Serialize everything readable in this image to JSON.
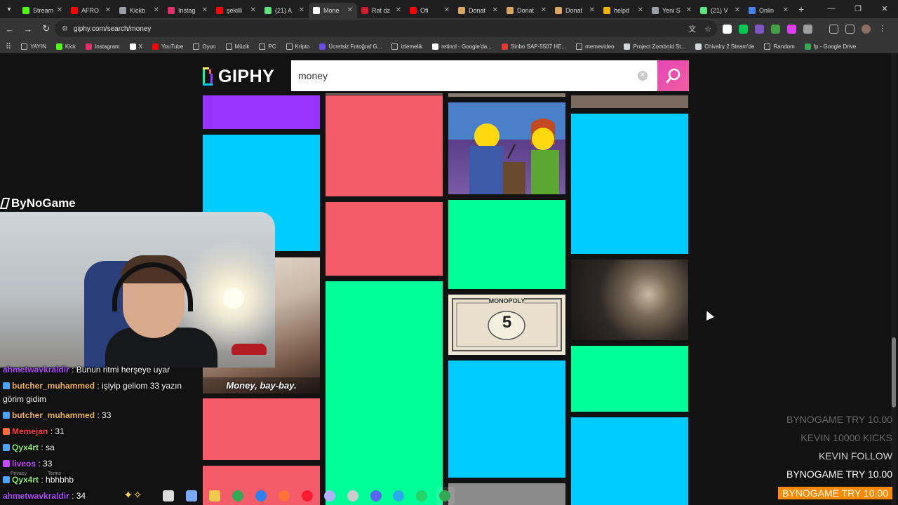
{
  "browser": {
    "tabs": [
      {
        "label": "Stream",
        "color": "#53fc18"
      },
      {
        "label": "AFRO",
        "color": "#ff0000"
      },
      {
        "label": "Kickb",
        "color": "#9aa0a6"
      },
      {
        "label": "Instag",
        "color": "#e1306c"
      },
      {
        "label": "şekilli",
        "color": "#ff0000"
      },
      {
        "label": "(21) A",
        "color": "#5ee37f"
      },
      {
        "label": "Mone",
        "color": "#ffffff",
        "active": true
      },
      {
        "label": "Rat dz",
        "color": "#d11a2a"
      },
      {
        "label": "Ofi",
        "color": "#ff0000"
      },
      {
        "label": "Donat",
        "color": "#d9a760"
      },
      {
        "label": "Donat",
        "color": "#d9a760"
      },
      {
        "label": "Donat",
        "color": "#d9a760"
      },
      {
        "label": "helpd",
        "color": "#f4b400"
      },
      {
        "label": "Yeni S",
        "color": "#9aa0a6"
      },
      {
        "label": "(21) V",
        "color": "#5ee37f"
      },
      {
        "label": "Onlin",
        "color": "#4285f4"
      }
    ],
    "url": "giphy.com/search/money",
    "bookmarks": [
      {
        "label": "YAYIN",
        "color": "folder"
      },
      {
        "label": "Kick",
        "color": "#53fc18"
      },
      {
        "label": "Instagram",
        "color": "#e1306c"
      },
      {
        "label": "X",
        "color": "#ffffff"
      },
      {
        "label": "YouTube",
        "color": "#ff0000"
      },
      {
        "label": "Oyun",
        "color": "folder"
      },
      {
        "label": "Müzik",
        "color": "folder"
      },
      {
        "label": "PC",
        "color": "folder"
      },
      {
        "label": "Kripto",
        "color": "folder"
      },
      {
        "label": "Ücretsiz Fotoğraf G...",
        "color": "#6b4ce6"
      },
      {
        "label": "izlemelik",
        "color": "folder"
      },
      {
        "label": "retinol - Google'da...",
        "color": "#ffffff"
      },
      {
        "label": "Sinbo SAP-5507 HE...",
        "color": "#e53935"
      },
      {
        "label": "memevideo",
        "color": "folder"
      },
      {
        "label": "Project Zomboid St...",
        "color": "#cfd8dc"
      },
      {
        "label": "Chivalry 2 Steam'de",
        "color": "#cfd8dc"
      },
      {
        "label": "Random",
        "color": "folder"
      },
      {
        "label": "fp - Google Drive",
        "color": "#34a853"
      }
    ]
  },
  "giphy": {
    "logo": "GIPHY",
    "search_value": "money",
    "gifs": [
      {
        "name": "gif-purple",
        "kind": "purple"
      },
      {
        "name": "gif-cyan-1",
        "kind": "cyan"
      },
      {
        "name": "gif-money-baybay",
        "kind": "photo",
        "caption": "Money, bay-bay."
      },
      {
        "name": "gif-red-1",
        "kind": "red"
      },
      {
        "name": "gif-red-2",
        "kind": "red"
      },
      {
        "name": "gif-red-3",
        "kind": "red"
      },
      {
        "name": "gif-red-4",
        "kind": "red"
      },
      {
        "name": "gif-green-1",
        "kind": "green"
      },
      {
        "name": "gif-simpsons",
        "kind": "simpsons"
      },
      {
        "name": "gif-green-2",
        "kind": "green"
      },
      {
        "name": "gif-monopoly",
        "kind": "monopoly",
        "caption": "MONOPOLY",
        "number": "5"
      },
      {
        "name": "gif-cyan-2",
        "kind": "cyan"
      },
      {
        "name": "gif-cyan-3",
        "kind": "cyan"
      },
      {
        "name": "gif-money-sniff",
        "kind": "photo"
      },
      {
        "name": "gif-green-3",
        "kind": "green"
      },
      {
        "name": "gif-cyan-4",
        "kind": "cyan"
      },
      {
        "name": "gif-strip-top-2",
        "kind": "photo"
      },
      {
        "name": "gif-strip-top-3",
        "kind": "photo"
      },
      {
        "name": "gif-strip-top-4",
        "kind": "photo"
      },
      {
        "name": "gif-strip-bottom",
        "kind": "photo"
      }
    ]
  },
  "overlay": {
    "brand": "ByNoGame",
    "chat": [
      {
        "user": "ahmetwavkraldir",
        "text": ": Bunun ritmi herşeye uyar",
        "user_color": "#b04bff",
        "badge": ""
      },
      {
        "user": "butcher_muhammed",
        "text": ": işiyip geliom 33 yazın",
        "user_color": "#f2b84b",
        "badge": "#4aa3ff"
      },
      {
        "user": "",
        "text": "görim gidim",
        "user_color": "#ffffff",
        "badge": ""
      },
      {
        "user": "butcher_muhammed",
        "text": ": 33",
        "user_color": "#f2b84b",
        "badge": "#4aa3ff"
      },
      {
        "user": "Memejan",
        "text": ": 31",
        "user_color": "#ff3b3b",
        "badge": "#ff6a3d"
      },
      {
        "user": "Qyx4rt",
        "text": ": sa",
        "user_color": "#8af26b",
        "badge": "#4aa3ff"
      },
      {
        "user": "liveos",
        "text": ": 33",
        "user_color": "#c24bff",
        "badge": "#c24bff"
      },
      {
        "user": "Qyx4rt",
        "text": ": hbhbhb",
        "user_color": "#8af26b",
        "badge": "#4aa3ff"
      },
      {
        "user": "ahmetwavkraldir",
        "text": ": 34",
        "user_color": "#b04bff",
        "badge": ""
      }
    ],
    "footer_privacy": "Privacy",
    "footer_terms": "Terms",
    "alerts": [
      {
        "text": "BYNOGAME  TRY 10.00",
        "style": "faded"
      },
      {
        "text": "KEVIN  10000 KICKS",
        "style": "faded"
      },
      {
        "text": "KEVIN  FOLLOW",
        "style": "normal"
      },
      {
        "text": "BYNOGAME  TRY 10.00",
        "style": "bright"
      },
      {
        "text": "BYNOGAME  TRY 10.00",
        "style": "active"
      }
    ]
  },
  "taskbar": {
    "icons": [
      "task-view-icon",
      "copilot-icon",
      "file-explorer-icon",
      "chrome-icon",
      "outlook-icon",
      "firefox-icon",
      "opera-icon",
      "app-icon",
      "obs-icon",
      "discord-icon",
      "telegram-icon",
      "whatsapp-icon",
      "chrome-active-icon"
    ]
  }
}
